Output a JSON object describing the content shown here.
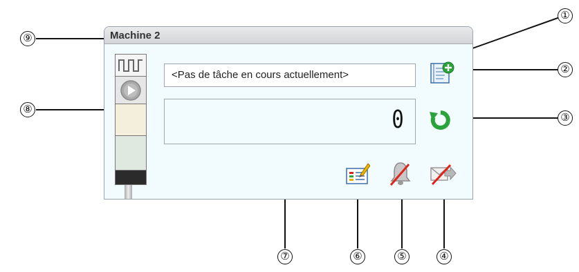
{
  "panel": {
    "title": "Machine 2",
    "task_text": "<Pas de tâche en cours actuellement>",
    "counter_value": "0"
  },
  "status_tower": {
    "segments": [
      "pulse",
      "play",
      "yellow",
      "green",
      "black"
    ],
    "colors": {
      "pulse_bg": "#f4f4f4",
      "play_bg": "#e6e6e6",
      "yellow": "#f4efdc",
      "green": "#e0e9e0",
      "black": "#2b2b2b"
    }
  },
  "icons": {
    "add_task": "notebook-add-icon",
    "refresh": "refresh-icon",
    "edit_report": "edit-report-icon",
    "alarm_disabled": "bell-disabled-icon",
    "message_disabled": "message-forward-disabled-icon"
  },
  "callouts": {
    "c1": "①",
    "c2": "②",
    "c3": "③",
    "c4": "④",
    "c5": "⑤",
    "c6": "⑥",
    "c7": "⑦",
    "c8": "⑧",
    "c9": "⑨"
  },
  "colors": {
    "panel_bg": "#f2fbfd",
    "refresh_green": "#2aa33a",
    "disabled_red": "#e0241b"
  }
}
